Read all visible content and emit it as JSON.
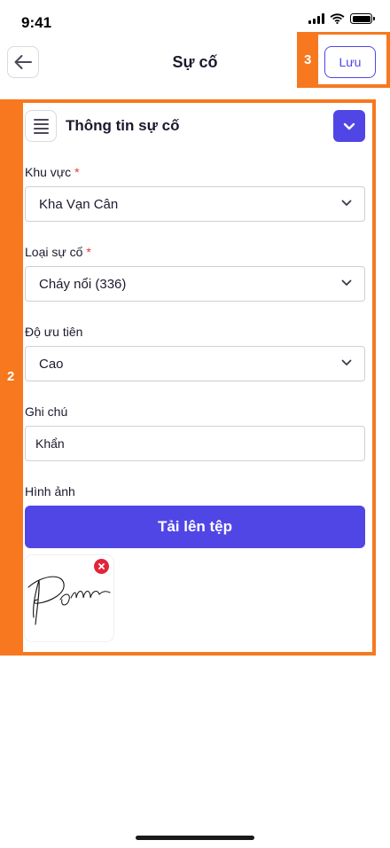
{
  "status_bar": {
    "time": "9:41",
    "icons": [
      "cellular-signal-icon",
      "wifi-icon",
      "battery-icon"
    ]
  },
  "header": {
    "title": "Sự cố",
    "back_icon": "arrow-left-icon",
    "save_label": "Lưu",
    "save_annotation": "3"
  },
  "form": {
    "annotation": "2",
    "section_title": "Thông tin sự cố",
    "menu_icon": "hamburger-menu-icon",
    "collapse_icon": "chevron-down-icon",
    "fields": {
      "area": {
        "label": "Khu vực",
        "required_mark": "*",
        "value": "Kha Vạn Cân"
      },
      "incident_type": {
        "label": "Loại sự cố",
        "required_mark": "*",
        "value": "Cháy nổi (336)"
      },
      "priority": {
        "label": "Độ ưu tiên",
        "value": "Cao"
      },
      "note": {
        "label": "Ghi chú",
        "value": "Khẩn"
      },
      "images": {
        "label": "Hình ảnh",
        "upload_label": "Tải lên tệp"
      }
    },
    "attachments": [
      {
        "type": "signature-image",
        "remove_icon": "close-circle-icon"
      }
    ]
  },
  "colors": {
    "accent": "#5046e5",
    "annotation_highlight": "#f7781e",
    "required": "#e53935",
    "remove": "#e2253a"
  }
}
